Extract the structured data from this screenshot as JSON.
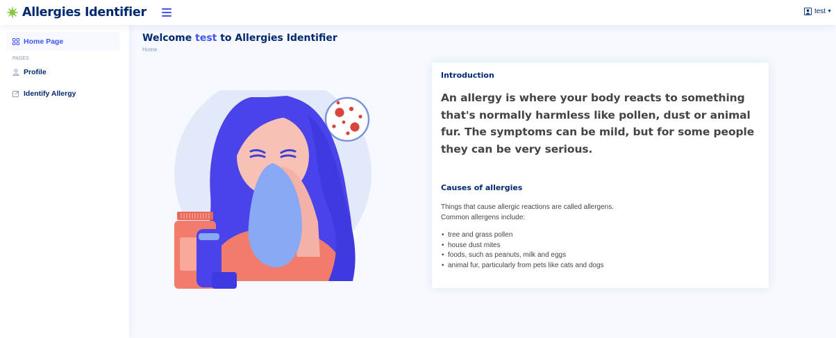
{
  "app": {
    "title": "Allergies Identifier"
  },
  "header": {
    "user_name": "test"
  },
  "sidebar": {
    "home": "Home Page",
    "section_heading": "PAGES",
    "items": [
      {
        "label": "Profile"
      },
      {
        "label": "Identify Allergy"
      }
    ]
  },
  "page": {
    "title_prefix": "Welcome",
    "title_user": "test",
    "title_suffix": "to Allergies Identifier",
    "breadcrumb": "Home"
  },
  "card": {
    "heading": "Introduction",
    "intro": "An allergy is where your body reacts to something that's normally harmless like pollen, dust or animal fur. The symptoms can be mild, but for some people they can be very serious.",
    "causes_heading": "Causes of allergies",
    "causes_p1": "Things that cause allergic reactions are called allergens.",
    "causes_p2": "Common allergens include:",
    "causes_list": [
      "tree and grass pollen",
      "house dust mites",
      "foods, such as peanuts, milk and eggs",
      "animal fur, particularly from pets like cats and dogs"
    ]
  },
  "colors": {
    "brand": "#012970",
    "accent": "#4154f1",
    "virus": "#d9443c"
  }
}
